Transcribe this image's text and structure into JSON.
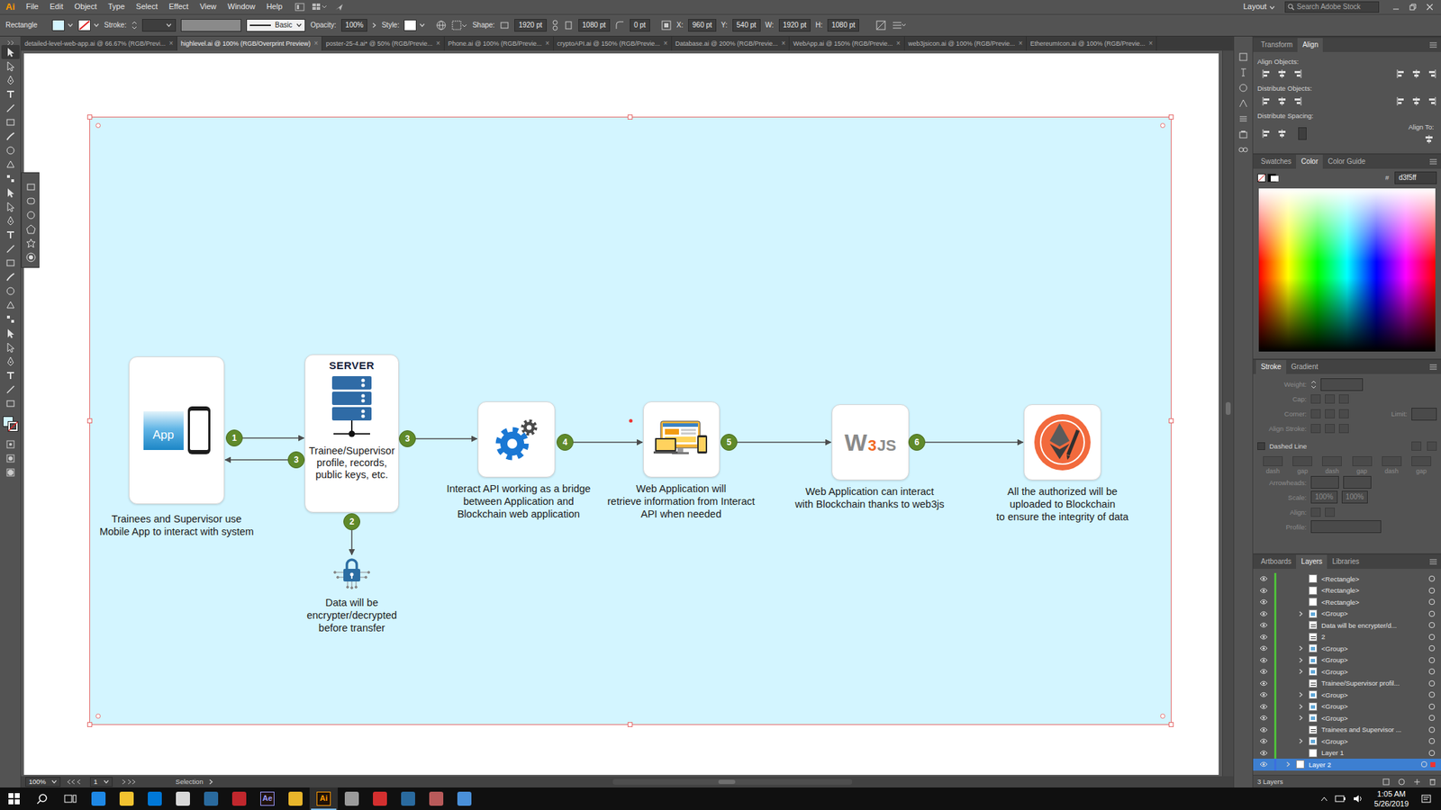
{
  "app": {
    "logo": "Ai",
    "menu": [
      "File",
      "Edit",
      "Object",
      "Type",
      "Select",
      "Effect",
      "View",
      "Window",
      "Help"
    ],
    "workspace": "Layout",
    "search": {
      "placeholder": "Search Adobe Stock"
    }
  },
  "control_bar": {
    "tool": "Rectangle",
    "stroke_label": "Stroke:",
    "brush": "Basic",
    "opacity_label": "Opacity:",
    "opacity": "100%",
    "style_label": "Style:",
    "shape_label": "Shape:",
    "shape_fields": [
      "1920 pt",
      "1080 pt",
      "0 pt"
    ],
    "position_fields": [
      {
        "label": "X:",
        "value": "960 pt"
      },
      {
        "label": "Y:",
        "value": "540 pt"
      },
      {
        "label": "W:",
        "value": "1920 pt"
      },
      {
        "label": "H:",
        "value": "1080 pt"
      }
    ]
  },
  "tabs": [
    {
      "label": "detailed-level-web-app.ai @ 66.67% (RGB/Previ...",
      "selected": false
    },
    {
      "label": "highlevel.ai @ 100% (RGB/Overprint Preview)",
      "selected": true
    },
    {
      "label": "poster-25-4.ai* @ 50% (RGB/Previe...",
      "selected": false
    },
    {
      "label": "Phone.ai @ 100% (RGB/Previe...",
      "selected": false
    },
    {
      "label": "cryptoAPI.ai @ 150% (RGB/Previe...",
      "selected": false
    },
    {
      "label": "Database.ai @ 200% (RGB/Previe...",
      "selected": false
    },
    {
      "label": "WebApp.ai @ 150% (RGB/Previe...",
      "selected": false
    },
    {
      "label": "web3jsicon.ai @ 100% (RGB/Previe...",
      "selected": false
    },
    {
      "label": "EthereumIcon.ai @ 100% (RGB/Previe...",
      "selected": false
    }
  ],
  "tab_close": "×",
  "tools": [
    {
      "selected": true
    },
    {
      "selected": false
    },
    {
      "selected": false
    },
    {
      "selected": false
    },
    {
      "selected": false
    },
    {
      "selected": false
    },
    {
      "selected": false
    },
    {
      "selected": false
    },
    {
      "selected": false
    },
    {
      "selected": false
    },
    {
      "selected": false
    },
    {
      "selected": false
    },
    {
      "selected": false
    },
    {
      "selected": false
    },
    {
      "selected": false
    },
    {
      "selected": false
    },
    {
      "selected": false
    },
    {
      "selected": false
    },
    {
      "selected": false
    },
    {
      "selected": false
    },
    {
      "selected": false
    },
    {
      "selected": false
    },
    {
      "selected": false
    },
    {
      "selected": false
    },
    {
      "selected": false
    },
    {
      "selected": false
    }
  ],
  "diagram": {
    "steps": [
      "1",
      "3",
      "2",
      "3",
      "4",
      "5",
      "6"
    ],
    "app": {
      "label": "App",
      "caption": [
        "Trainees and Supervisor use",
        "Mobile App to interact with system"
      ]
    },
    "server": {
      "title": "SERVER",
      "text": [
        "Trainee/Supervisor",
        "profile, records,",
        "public keys, etc."
      ]
    },
    "lock": {
      "caption": [
        "Data will be",
        "encrypter/decrypted",
        "before transfer"
      ]
    },
    "api": {
      "caption": [
        "Interact API working as a bridge",
        "between Application and",
        "Blockchain web application"
      ]
    },
    "webapp": {
      "caption": [
        "Web Application will",
        "retrieve information from Interact",
        "API when needed"
      ]
    },
    "web3js": {
      "logo": [
        "W",
        "3",
        "JS"
      ],
      "caption": [
        "Web Application can interact",
        "with Blockchain thanks to web3js"
      ]
    },
    "ethereum": {
      "caption": [
        "All the authorized will be",
        "uploaded to Blockchain",
        "to ensure the integrity of data"
      ]
    }
  },
  "status_bar": {
    "zoom": "100%",
    "artboard": "1",
    "tool": "Selection"
  },
  "panels": {
    "align": {
      "tabs": [
        {
          "label": "Transform",
          "selected": false
        },
        {
          "label": "Align",
          "selected": true
        }
      ],
      "sections": [
        "Align Objects:",
        "Distribute Objects:",
        "Distribute Spacing:"
      ],
      "align_to": "Align To:"
    },
    "color": {
      "tabs": [
        {
          "label": "Swatches",
          "selected": false
        },
        {
          "label": "Color",
          "selected": true
        },
        {
          "label": "Color Guide",
          "selected": false
        }
      ],
      "hash": "#",
      "hex": "d3f5ff"
    },
    "stroke": {
      "tabs": [
        {
          "label": "Stroke",
          "selected": true
        },
        {
          "label": "Gradient",
          "selected": false
        }
      ],
      "disabled": true,
      "weight": "Weight:",
      "cap": "Cap:",
      "corner": "Corner:",
      "limit": "Limit:",
      "align_stroke": "Align Stroke:",
      "dashed": "Dashed Line",
      "dashed_checked": false,
      "dash_labels": [
        "dash",
        "gap",
        "dash",
        "gap",
        "dash",
        "gap"
      ],
      "arrowheads": "Arrowheads:",
      "scale": "Scale:",
      "scale_values": [
        "100%",
        "100%"
      ],
      "align": "Align:",
      "profile": "Profile:"
    },
    "layers": {
      "tabs": [
        {
          "label": "Artboards",
          "selected": false
        },
        {
          "label": "Layers",
          "selected": true
        },
        {
          "label": "Libraries",
          "selected": false
        }
      ],
      "rows": [
        {
          "name": "<Rectangle>",
          "kind": "item",
          "expandable": false,
          "selected": false,
          "color": "#4fbf3a"
        },
        {
          "name": "<Rectangle>",
          "kind": "item",
          "expandable": false,
          "selected": false,
          "color": "#4fbf3a"
        },
        {
          "name": "<Rectangle>",
          "kind": "item",
          "expandable": false,
          "selected": false,
          "color": "#4fbf3a"
        },
        {
          "name": "<Group>",
          "kind": "group",
          "expandable": true,
          "selected": false,
          "color": "#4fbf3a"
        },
        {
          "name": "Data will be  encrypter/d...",
          "kind": "text",
          "expandable": false,
          "selected": false,
          "color": "#4fbf3a"
        },
        {
          "name": "2",
          "kind": "text",
          "expandable": false,
          "selected": false,
          "color": "#4fbf3a"
        },
        {
          "name": "<Group>",
          "kind": "group",
          "expandable": true,
          "selected": false,
          "color": "#4fbf3a"
        },
        {
          "name": "<Group>",
          "kind": "group",
          "expandable": true,
          "selected": false,
          "color": "#4fbf3a"
        },
        {
          "name": "<Group>",
          "kind": "group",
          "expandable": true,
          "selected": false,
          "color": "#4fbf3a"
        },
        {
          "name": "Trainee/Supervisor  profil...",
          "kind": "text",
          "expandable": false,
          "selected": false,
          "color": "#4fbf3a"
        },
        {
          "name": "<Group>",
          "kind": "group",
          "expandable": true,
          "selected": false,
          "color": "#4fbf3a"
        },
        {
          "name": "<Group>",
          "kind": "group",
          "expandable": true,
          "selected": false,
          "color": "#4fbf3a"
        },
        {
          "name": "<Group>",
          "kind": "group",
          "expandable": true,
          "selected": false,
          "color": "#4fbf3a"
        },
        {
          "name": "Trainees and Supervisor ...",
          "kind": "text",
          "expandable": false,
          "selected": false,
          "color": "#4fbf3a"
        },
        {
          "name": "<Group>",
          "kind": "group",
          "expandable": true,
          "selected": false,
          "color": "#4fbf3a"
        },
        {
          "name": "Layer 1",
          "kind": "item",
          "expandable": false,
          "selected": false,
          "color": "#4fbf3a"
        },
        {
          "name": "Layer 2",
          "kind": "layer",
          "expandable": true,
          "selected": true,
          "color": "#3a6fe0"
        }
      ],
      "footer": "3 Layers"
    }
  },
  "taskbar": {
    "apps": [
      {
        "kind": "icon",
        "color": "#1e88e5",
        "selected": false
      },
      {
        "kind": "icon",
        "color": "#f2c230",
        "selected": false
      },
      {
        "kind": "icon",
        "color": "#0078d7",
        "selected": false
      },
      {
        "kind": "icon",
        "color": "#d8d8d8",
        "selected": false
      },
      {
        "kind": "icon",
        "color": "#2a6a9e",
        "selected": false
      },
      {
        "kind": "icon",
        "color": "#c1272d",
        "selected": false
      },
      {
        "kind": "glyph",
        "label": "Ae",
        "color": "#9999ff",
        "selected": false
      },
      {
        "kind": "icon",
        "color": "#e8b52b",
        "selected": false
      },
      {
        "kind": "glyph",
        "label": "Ai",
        "color": "#ff9a00",
        "selected": true
      },
      {
        "kind": "icon",
        "color": "#9a9a9a",
        "selected": false
      },
      {
        "kind": "icon",
        "color": "#d32f2f",
        "selected": false
      },
      {
        "kind": "icon",
        "color": "#2a6a9e",
        "selected": false
      },
      {
        "kind": "icon",
        "color": "#b85a5a",
        "selected": false
      },
      {
        "kind": "icon",
        "color": "#4a90d9",
        "selected": false
      }
    ],
    "time": "1:05 AM",
    "date": "5/26/2019"
  }
}
